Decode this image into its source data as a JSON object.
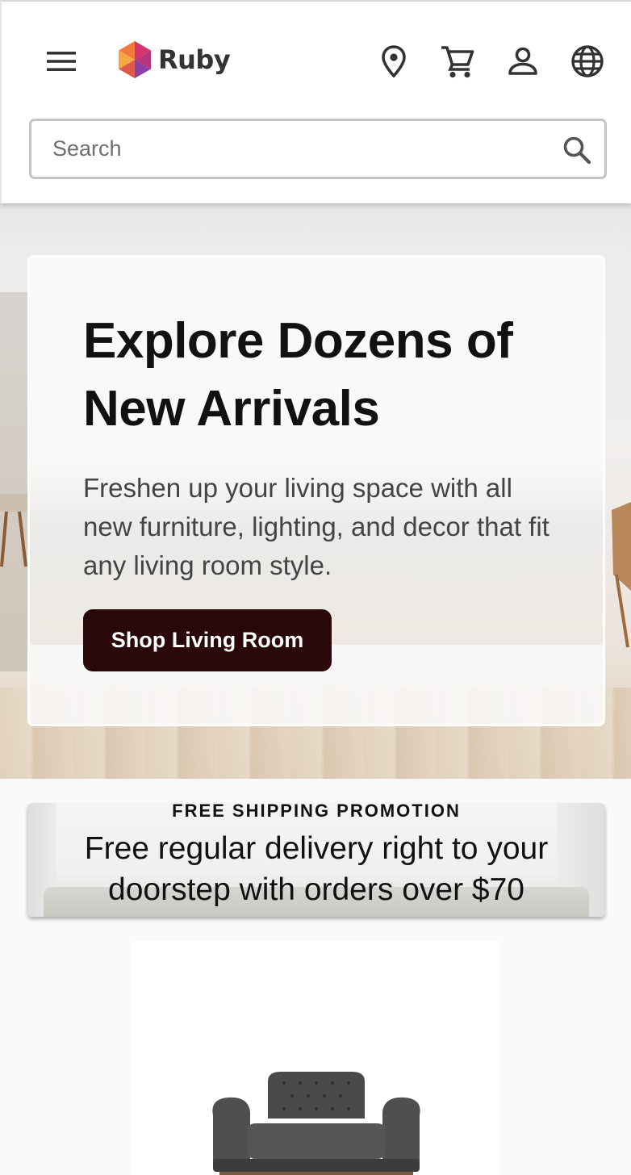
{
  "header": {
    "brand_name": "Ruby",
    "icons": {
      "menu": "hamburger-menu-icon",
      "logo": "hexagon-logo-icon",
      "location": "location-pin-icon",
      "cart": "shopping-cart-icon",
      "account": "person-icon",
      "language": "globe-icon"
    }
  },
  "search": {
    "placeholder": "Search",
    "value": "",
    "icon": "search-icon"
  },
  "hero": {
    "title": "Explore Dozens of New Arrivals",
    "subtitle": "Freshen up your living space with all new furniture, lighting, and decor that fit any living room style.",
    "cta_label": "Shop Living Room",
    "cta_color": "#2a0709"
  },
  "promo": {
    "eyebrow": "FREE SHIPPING PROMOTION",
    "text": "Free regular delivery right to your doorstep with orders over $70"
  },
  "product": {
    "image": "tufted-armchair-image"
  },
  "colors": {
    "brand_dark": "#2a0709",
    "logo_pink": "#d6336c",
    "logo_orange": "#f4a742",
    "logo_purple": "#8e3fa3"
  }
}
